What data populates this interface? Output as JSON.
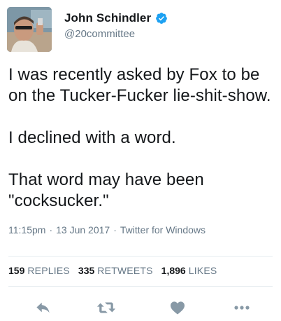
{
  "user": {
    "display_name": "John Schindler",
    "handle": "@20committee",
    "verified": true
  },
  "tweet": {
    "paragraphs": [
      "I was recently asked by Fox to be on the Tucker-Fucker lie-shit-show.",
      "I declined with a word.",
      "That word may have been \"cocksucker.\""
    ],
    "time": "11:15pm",
    "date": "13 Jun 2017",
    "source": "Twitter for Windows",
    "separator": "·"
  },
  "stats": {
    "replies_count": "159",
    "replies_label": "REPLIES",
    "retweets_count": "335",
    "retweets_label": "RETWEETS",
    "likes_count": "1,896",
    "likes_label": "LIKES"
  },
  "colors": {
    "verified": "#1da1f2",
    "icon_gray": "#8899a6",
    "meta_gray": "#657786",
    "text": "#14171a"
  },
  "icons": {
    "reply": "reply-icon",
    "retweet": "retweet-icon",
    "like": "heart-icon",
    "more": "more-icon",
    "verified": "verified-badge-icon"
  }
}
